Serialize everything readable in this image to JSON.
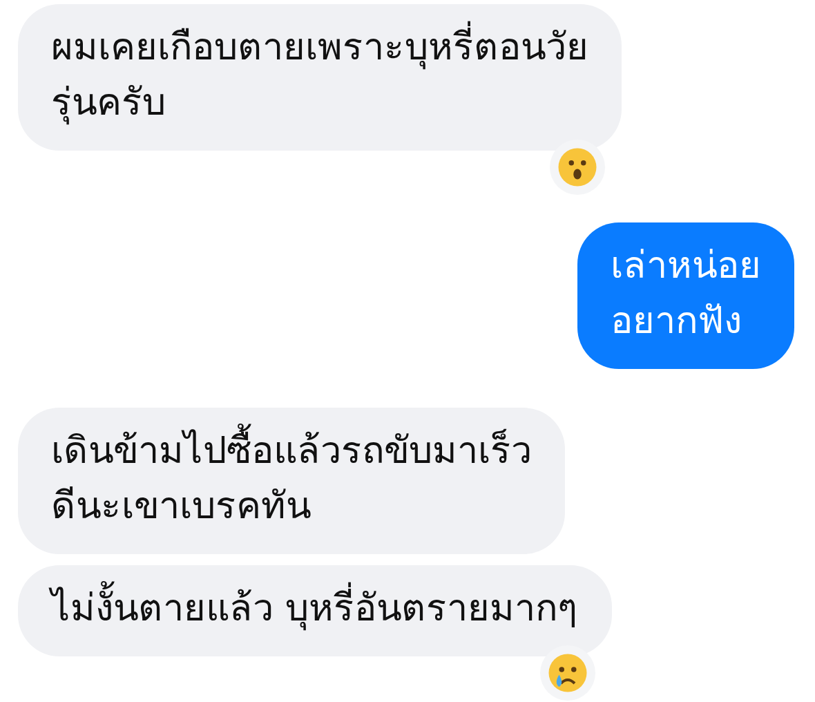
{
  "messages": [
    {
      "kind": "incoming",
      "lines": [
        "ผมเคยเกือบตายเพราะบุหรี่ตอนวัย",
        "รุ่นครับ"
      ],
      "reaction": {
        "kind": "surprised"
      }
    },
    {
      "kind": "outgoing",
      "lines": [
        "เล่าหน่อย",
        "อยากฟัง"
      ]
    },
    {
      "kind": "incoming",
      "lines": [
        "เดินข้ามไปซื้อแล้วรถขับมาเร็ว",
        "ดีนะเขาเบรคทัน"
      ]
    },
    {
      "kind": "incoming",
      "lines": [
        "ไม่งั้นตายแล้ว บุหรี่อันตรายมากๆ"
      ],
      "reaction": {
        "kind": "crying"
      }
    }
  ]
}
